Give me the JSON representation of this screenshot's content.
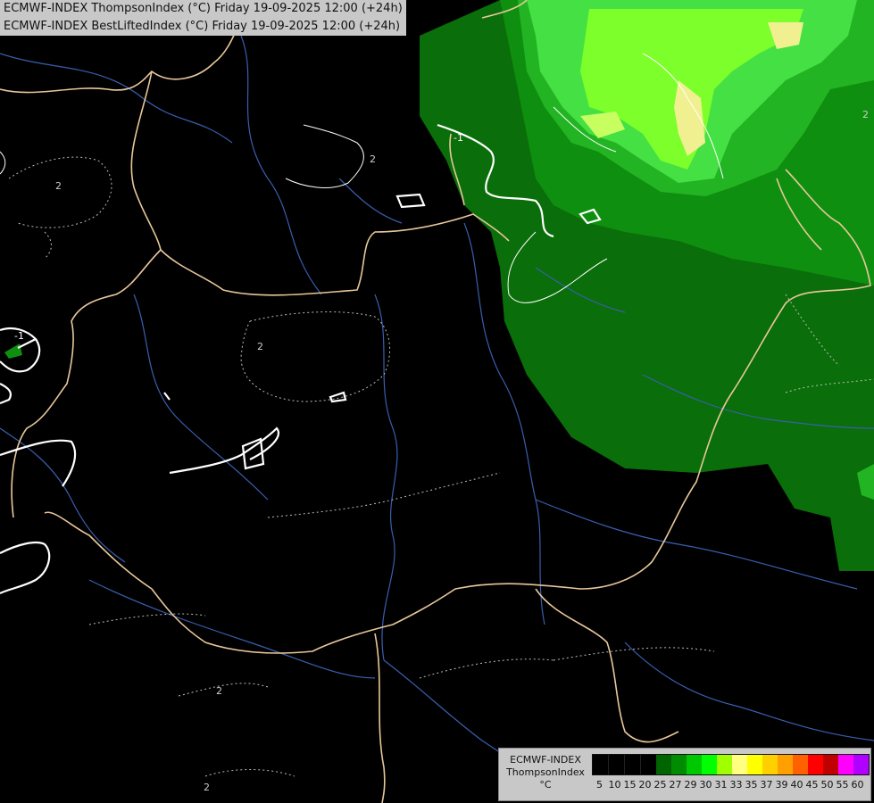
{
  "header": {
    "line1": "ECMWF-INDEX ThompsonIndex (°C) Friday 19-09-2025 12:00 (+24h)",
    "line2": "ECMWF-INDEX BestLiftedIndex (°C) Friday 19-09-2025 12:00 (+24h)"
  },
  "legend": {
    "title_line1": "ECMWF-INDEX",
    "title_line2": "ThompsonIndex",
    "unit": "°C",
    "colors": [
      "#000000",
      "#000000",
      "#000000",
      "#000000",
      "#006400",
      "#008c00",
      "#00c800",
      "#00ff00",
      "#a0ff00",
      "#ffff80",
      "#ffff00",
      "#ffd000",
      "#ffa000",
      "#ff6000",
      "#ff0000",
      "#c00000",
      "#ff00ff",
      "#b000ff",
      "#8000ff",
      "#4000ff",
      "#0000ff"
    ],
    "ticks": [
      "5",
      "10",
      "15",
      "20",
      "25",
      "27",
      "29",
      "30",
      "31",
      "33",
      "35",
      "37",
      "39",
      "40",
      "45",
      "50",
      "55",
      "60"
    ]
  },
  "map_labels": {
    "contour_a": "-1",
    "contour_b": "-1",
    "contour_c": "2",
    "contour_d": "2",
    "contour_e": "2",
    "contour_f": "2",
    "contour_g": "2",
    "contour_h": "2"
  },
  "fill_colors": {
    "dark_green": "#005a00",
    "mid_green": "#0a7a0a",
    "green": "#1aa51a",
    "bright_green": "#3ed93e",
    "lime": "#7cff2a",
    "pale_yellow": "#f0f090",
    "border": "#e8c79a",
    "river": "#3a5fb0",
    "contour": "#ffffff"
  }
}
